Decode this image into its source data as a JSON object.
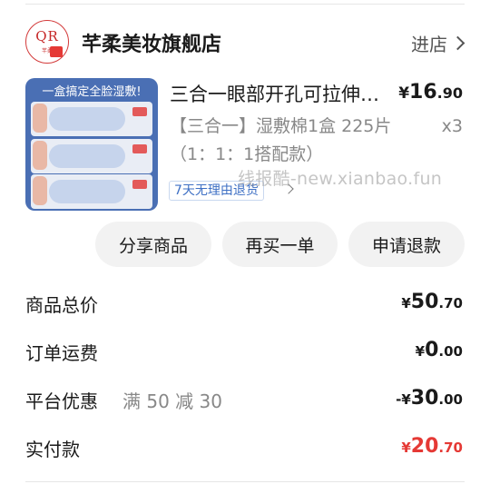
{
  "shop": {
    "logo_text": "QR",
    "logo_sub": "芊柔",
    "name": "芊柔美妆旗舰店",
    "enter_label": "进店"
  },
  "product": {
    "image_banner": "一盒搞定全脸湿敷!",
    "title": "三合一眼部开孔可拉伸湿敷棉",
    "price": {
      "currency": "¥",
      "int": "16",
      "dec": ".90"
    },
    "spec": "【三合一】湿敷棉1盒 225片（1：1：1搭配款）",
    "quantity": "x3",
    "return_badge": "7天无理由退货"
  },
  "watermark": "线报酷-new.xianbao.fun",
  "actions": {
    "share": "分享商品",
    "rebuy": "再买一单",
    "refund": "申请退款"
  },
  "summary": {
    "total_label": "商品总价",
    "total": {
      "currency": "¥",
      "int": "50",
      "dec": ".70"
    },
    "shipping_label": "订单运费",
    "shipping": {
      "currency": "¥",
      "int": "0",
      "dec": ".00"
    },
    "discount_label": "平台优惠",
    "discount_desc": "满 50 减 30",
    "discount": {
      "currency": "-¥",
      "int": "30",
      "dec": ".00"
    },
    "paid_label": "实付款",
    "paid": {
      "currency": "¥",
      "int": "20",
      "dec": ".70"
    }
  },
  "colors": {
    "accent_red": "#e53935",
    "badge_blue": "#3d6fc4",
    "muted": "#888888"
  }
}
